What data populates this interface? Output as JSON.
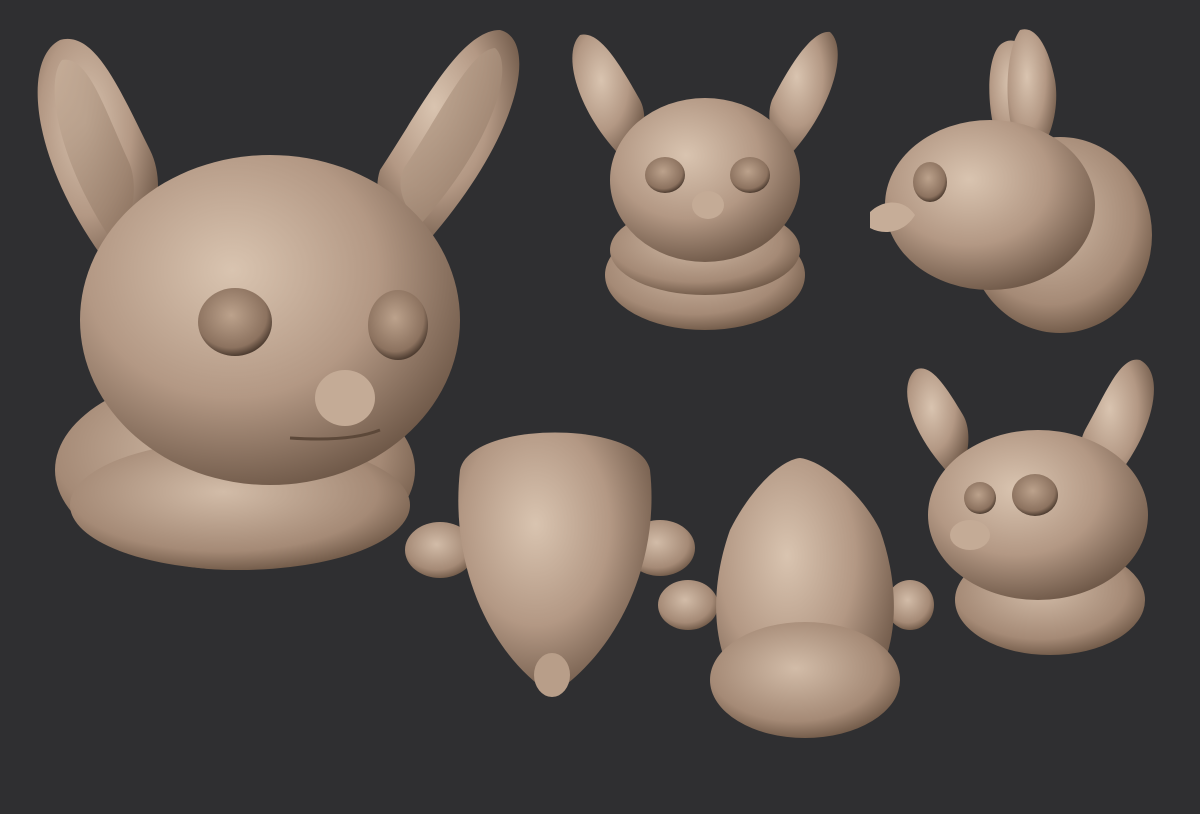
{
  "scene": {
    "background_color": "#2f2f31",
    "clay_color": "#b49a84",
    "clay_highlight": "#d8c2ad",
    "clay_shadow": "#5e4a3b"
  },
  "views": [
    {
      "name": "front-three-quarter-large"
    },
    {
      "name": "front"
    },
    {
      "name": "side-profile"
    },
    {
      "name": "top"
    },
    {
      "name": "bottom"
    },
    {
      "name": "three-quarter-small"
    }
  ]
}
